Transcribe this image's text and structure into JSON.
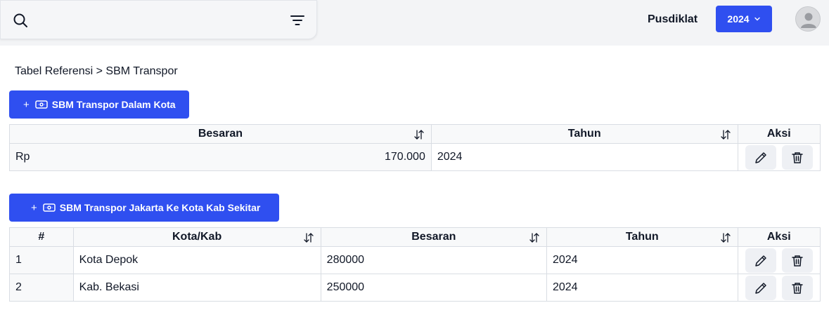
{
  "header": {
    "org_label": "Pusdiklat",
    "year_selected": "2024"
  },
  "breadcrumb": "Tabel Referensi > SBM Transpor",
  "section1": {
    "add_button_label": "SBM Transpor Dalam Kota",
    "columns": [
      "Besaran",
      "Tahun",
      "Aksi"
    ],
    "rows": [
      {
        "currency": "Rp",
        "besaran": "170.000",
        "tahun": "2024"
      }
    ]
  },
  "section2": {
    "add_button_label": "SBM Transpor Jakarta Ke Kota Kab Sekitar",
    "columns": [
      "#",
      "Kota/Kab",
      "Besaran",
      "Tahun",
      "Aksi"
    ],
    "rows": [
      {
        "no": "1",
        "kota": "Kota Depok",
        "besaran": "280000",
        "tahun": "2024"
      },
      {
        "no": "2",
        "kota": "Kab. Bekasi",
        "besaran": "250000",
        "tahun": "2024"
      }
    ]
  },
  "icons": {
    "search": "search-icon",
    "filter": "filter-icon",
    "chevron": "chevron-down-icon",
    "avatar": "user-icon",
    "money": "money-icon",
    "sort": "sort-icon",
    "edit": "pencil-icon",
    "delete": "trash-icon"
  },
  "colors": {
    "primary": "#2f4ff0",
    "topbar_bg": "#f3f4f6",
    "header_cell_bg": "#f8f9fa",
    "action_btn_bg": "#eef0f4"
  }
}
